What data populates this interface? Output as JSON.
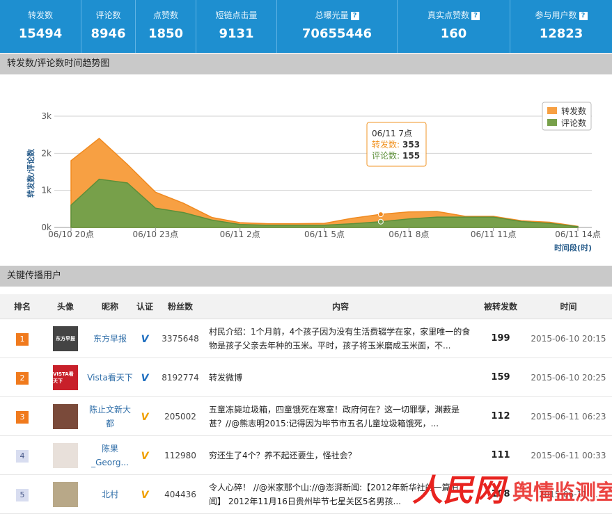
{
  "stats": [
    {
      "label": "转发数",
      "value": "15494",
      "help": false
    },
    {
      "label": "评论数",
      "value": "8946",
      "help": false
    },
    {
      "label": "点赞数",
      "value": "1850",
      "help": false
    },
    {
      "label": "短链点击量",
      "value": "9131",
      "help": false
    },
    {
      "label": "总曝光量",
      "value": "70655446",
      "help": true
    },
    {
      "label": "真实点赞数",
      "value": "160",
      "help": true
    },
    {
      "label": "参与用户数",
      "value": "12823",
      "help": true
    }
  ],
  "help_glyph": "?",
  "trend_section": {
    "title": "转发数/评论数时间趋势图"
  },
  "chart_data": {
    "type": "area",
    "ylabel": "转发数/评论数",
    "xlabel": "时间段(时)",
    "ylim": [
      0,
      3000
    ],
    "yticks": [
      "0k",
      "1k",
      "2k",
      "3k"
    ],
    "xticks": [
      "06/10 20点",
      "06/10 23点",
      "06/11 2点",
      "06/11 5点",
      "06/11 8点",
      "06/11 11点",
      "06/11 14点"
    ],
    "x": [
      "06/10 20点",
      "06/10 21点",
      "06/10 22点",
      "06/10 23点",
      "06/11 0点",
      "06/11 1点",
      "06/11 2点",
      "06/11 3点",
      "06/11 4点",
      "06/11 5点",
      "06/11 6点",
      "06/11 7点",
      "06/11 8点",
      "06/11 9点",
      "06/11 10点",
      "06/11 11点",
      "06/11 12点",
      "06/11 13点",
      "06/11 14点"
    ],
    "series": [
      {
        "name": "转发数",
        "color": "#f7a043",
        "values": [
          1800,
          2400,
          1700,
          950,
          650,
          270,
          130,
          100,
          100,
          110,
          250,
          353,
          420,
          430,
          300,
          300,
          180,
          140,
          30
        ]
      },
      {
        "name": "评论数",
        "color": "#77a04a",
        "values": [
          600,
          1300,
          1200,
          520,
          400,
          200,
          80,
          60,
          60,
          60,
          100,
          155,
          230,
          280,
          280,
          280,
          160,
          110,
          20
        ]
      }
    ],
    "legend_position": "top-right",
    "grid": true,
    "tooltip": {
      "title": "06/11 7点",
      "rows": [
        {
          "label": "转发数:",
          "value": "353",
          "color": "#f0901c"
        },
        {
          "label": "评论数:",
          "value": "155",
          "color": "#5d8f3a"
        }
      ]
    }
  },
  "users_section": {
    "title": "关键传播用户"
  },
  "table": {
    "headers": [
      "排名",
      "头像",
      "昵称",
      "认证",
      "粉丝数",
      "内容",
      "被转发数",
      "时间"
    ],
    "rows": [
      {
        "rank": "1",
        "avatar_text": "东方早报",
        "avatar_color": "#444444",
        "nick": "东方早报",
        "verify": "V",
        "verify_color": "blue",
        "fans": "3375648",
        "content": "村民介绍：1个月前，4个孩子因为没有生活费辍学在家，家里唯一的食物是孩子父亲去年种的玉米。平时，孩子将玉米磨成玉米面，不...",
        "reposts": "199",
        "time": "2015-06-10 20:15",
        "rank_style": "high"
      },
      {
        "rank": "2",
        "avatar_text": "VISTA看天下",
        "avatar_color": "#c8202a",
        "nick": "Vista看天下",
        "verify": "V",
        "verify_color": "blue",
        "fans": "8192774",
        "content": "转发微博",
        "reposts": "159",
        "time": "2015-06-10 20:25",
        "rank_style": "high"
      },
      {
        "rank": "3",
        "avatar_text": "",
        "avatar_color": "#7a4a3a",
        "nick": "陈止文新大都",
        "verify": "V",
        "verify_color": "gold",
        "fans": "205002",
        "content": "五童冻毙垃圾箱，四童饿死在寒室！政府何在？这一切罪孽，渊薮是甚？//@熊志明2015:记得因为毕节市五名儿童垃圾箱饿死，...",
        "reposts": "112",
        "time": "2015-06-11 06:23",
        "rank_style": "high"
      },
      {
        "rank": "4",
        "avatar_text": "",
        "avatar_color": "#e8e0da",
        "nick": "陈果_Georg...",
        "verify": "V",
        "verify_color": "gold",
        "fans": "112980",
        "content": "穷还生了4个？养不起还要生，怪社会？",
        "reposts": "111",
        "time": "2015-06-11 00:33",
        "rank_style": "low"
      },
      {
        "rank": "5",
        "avatar_text": "",
        "avatar_color": "#b8a888",
        "nick": "北村",
        "verify": "V",
        "verify_color": "gold",
        "fans": "404436",
        "content": "令人心碎！ //@米家那个山://@澎湃新闻:【2012年新华社的一篇旧闻】 2012年11月16日贵州毕节七星关区5名男孩...",
        "reposts": "108",
        "time": "2015-06-11 ...",
        "rank_style": "low"
      }
    ]
  },
  "watermark": {
    "logo_text": "人民网",
    "caption": "舆情监测室"
  }
}
